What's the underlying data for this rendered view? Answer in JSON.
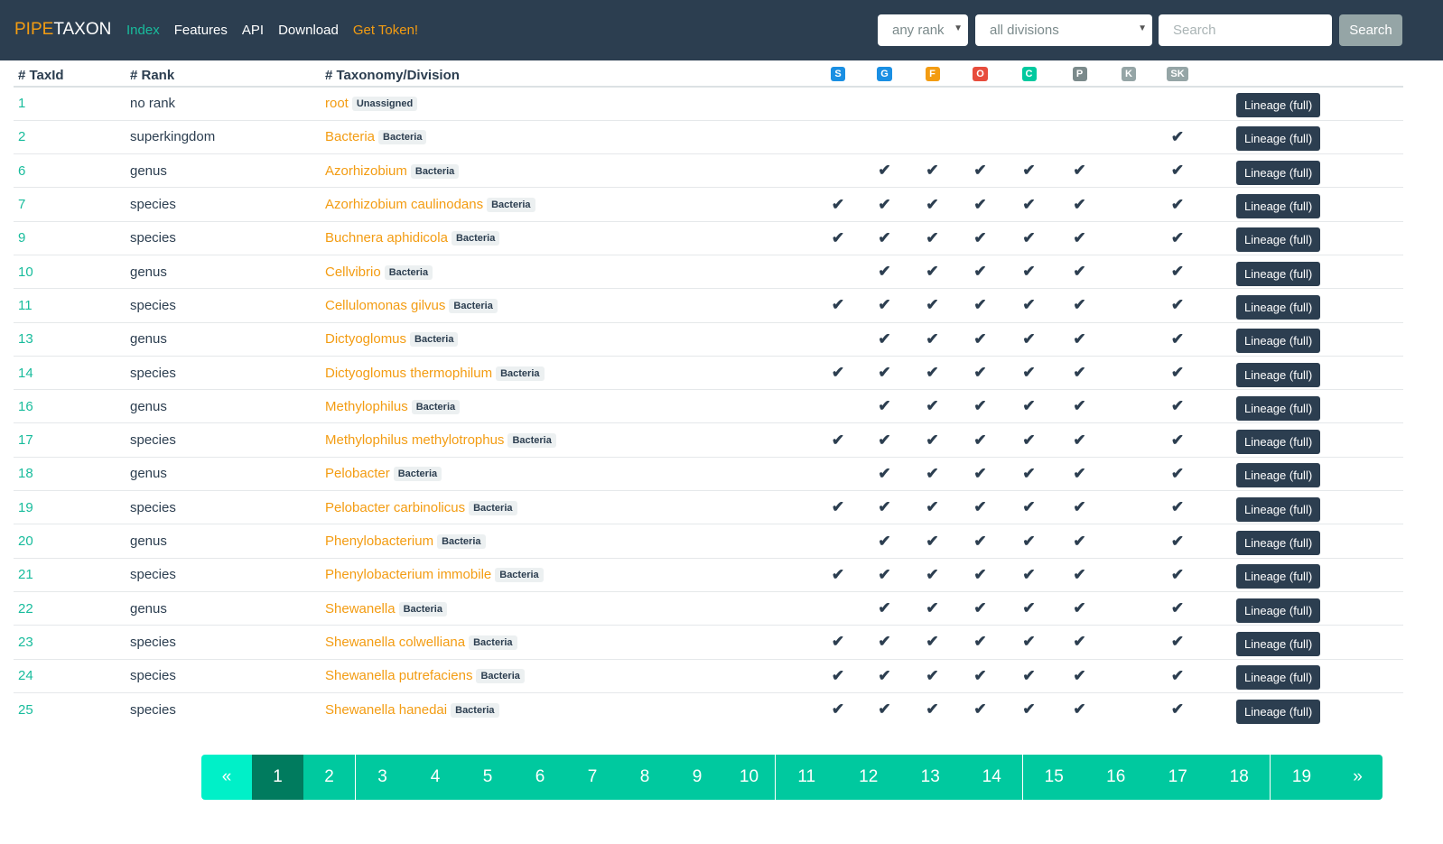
{
  "nav": {
    "brand_a": "PIPE",
    "brand_b": "TAXON",
    "links": [
      {
        "label": "Index",
        "cls": "active"
      },
      {
        "label": "Features",
        "cls": ""
      },
      {
        "label": "API",
        "cls": ""
      },
      {
        "label": "Download",
        "cls": ""
      },
      {
        "label": "Get Token!",
        "cls": "token"
      }
    ],
    "rank_select": "any rank",
    "division_select": "all divisions",
    "search_placeholder": "Search",
    "search_button": "Search"
  },
  "table": {
    "headers": [
      "# TaxId",
      "# Rank",
      "# Taxonomy/Division"
    ],
    "rank_badges": [
      {
        "label": "S",
        "color": "#1a8fe3"
      },
      {
        "label": "G",
        "color": "#1a8fe3"
      },
      {
        "label": "F",
        "color": "#f39c12"
      },
      {
        "label": "O",
        "color": "#e74c3c"
      },
      {
        "label": "C",
        "color": "#00c99f"
      },
      {
        "label": "P",
        "color": "#7b8a8b"
      },
      {
        "label": "K",
        "color": "#95a5a6"
      },
      {
        "label": "SK",
        "color": "#95a5a6"
      }
    ],
    "lineage_label": "Lineage (full)",
    "rows": [
      {
        "id": "1",
        "rank": "no rank",
        "name": "root",
        "division": "Unassigned",
        "checks": [
          0,
          0,
          0,
          0,
          0,
          0,
          0,
          0
        ]
      },
      {
        "id": "2",
        "rank": "superkingdom",
        "name": "Bacteria",
        "division": "Bacteria",
        "checks": [
          0,
          0,
          0,
          0,
          0,
          0,
          0,
          1
        ]
      },
      {
        "id": "6",
        "rank": "genus",
        "name": "Azorhizobium",
        "division": "Bacteria",
        "checks": [
          0,
          1,
          1,
          1,
          1,
          1,
          0,
          1
        ]
      },
      {
        "id": "7",
        "rank": "species",
        "name": "Azorhizobium caulinodans",
        "division": "Bacteria",
        "checks": [
          1,
          1,
          1,
          1,
          1,
          1,
          0,
          1
        ]
      },
      {
        "id": "9",
        "rank": "species",
        "name": "Buchnera aphidicola",
        "division": "Bacteria",
        "checks": [
          1,
          1,
          1,
          1,
          1,
          1,
          0,
          1
        ]
      },
      {
        "id": "10",
        "rank": "genus",
        "name": "Cellvibrio",
        "division": "Bacteria",
        "checks": [
          0,
          1,
          1,
          1,
          1,
          1,
          0,
          1
        ]
      },
      {
        "id": "11",
        "rank": "species",
        "name": "Cellulomonas gilvus",
        "division": "Bacteria",
        "checks": [
          1,
          1,
          1,
          1,
          1,
          1,
          0,
          1
        ]
      },
      {
        "id": "13",
        "rank": "genus",
        "name": "Dictyoglomus",
        "division": "Bacteria",
        "checks": [
          0,
          1,
          1,
          1,
          1,
          1,
          0,
          1
        ]
      },
      {
        "id": "14",
        "rank": "species",
        "name": "Dictyoglomus thermophilum",
        "division": "Bacteria",
        "checks": [
          1,
          1,
          1,
          1,
          1,
          1,
          0,
          1
        ]
      },
      {
        "id": "16",
        "rank": "genus",
        "name": "Methylophilus",
        "division": "Bacteria",
        "checks": [
          0,
          1,
          1,
          1,
          1,
          1,
          0,
          1
        ]
      },
      {
        "id": "17",
        "rank": "species",
        "name": "Methylophilus methylotrophus",
        "division": "Bacteria",
        "checks": [
          1,
          1,
          1,
          1,
          1,
          1,
          0,
          1
        ]
      },
      {
        "id": "18",
        "rank": "genus",
        "name": "Pelobacter",
        "division": "Bacteria",
        "checks": [
          0,
          1,
          1,
          1,
          1,
          1,
          0,
          1
        ]
      },
      {
        "id": "19",
        "rank": "species",
        "name": "Pelobacter carbinolicus",
        "division": "Bacteria",
        "checks": [
          1,
          1,
          1,
          1,
          1,
          1,
          0,
          1
        ]
      },
      {
        "id": "20",
        "rank": "genus",
        "name": "Phenylobacterium",
        "division": "Bacteria",
        "checks": [
          0,
          1,
          1,
          1,
          1,
          1,
          0,
          1
        ]
      },
      {
        "id": "21",
        "rank": "species",
        "name": "Phenylobacterium immobile",
        "division": "Bacteria",
        "checks": [
          1,
          1,
          1,
          1,
          1,
          1,
          0,
          1
        ]
      },
      {
        "id": "22",
        "rank": "genus",
        "name": "Shewanella",
        "division": "Bacteria",
        "checks": [
          0,
          1,
          1,
          1,
          1,
          1,
          0,
          1
        ]
      },
      {
        "id": "23",
        "rank": "species",
        "name": "Shewanella colwelliana",
        "division": "Bacteria",
        "checks": [
          1,
          1,
          1,
          1,
          1,
          1,
          0,
          1
        ]
      },
      {
        "id": "24",
        "rank": "species",
        "name": "Shewanella putrefaciens",
        "division": "Bacteria",
        "checks": [
          1,
          1,
          1,
          1,
          1,
          1,
          0,
          1
        ]
      },
      {
        "id": "25",
        "rank": "species",
        "name": "Shewanella hanedai",
        "division": "Bacteria",
        "checks": [
          1,
          1,
          1,
          1,
          1,
          1,
          0,
          1
        ]
      }
    ]
  },
  "pagination": {
    "prev": "«",
    "next": "»",
    "pages": [
      "1",
      "2",
      "3",
      "4",
      "5",
      "6",
      "7",
      "8",
      "9",
      "10",
      "11",
      "12",
      "13",
      "14",
      "15",
      "16",
      "17",
      "18",
      "19"
    ],
    "current": "1"
  }
}
